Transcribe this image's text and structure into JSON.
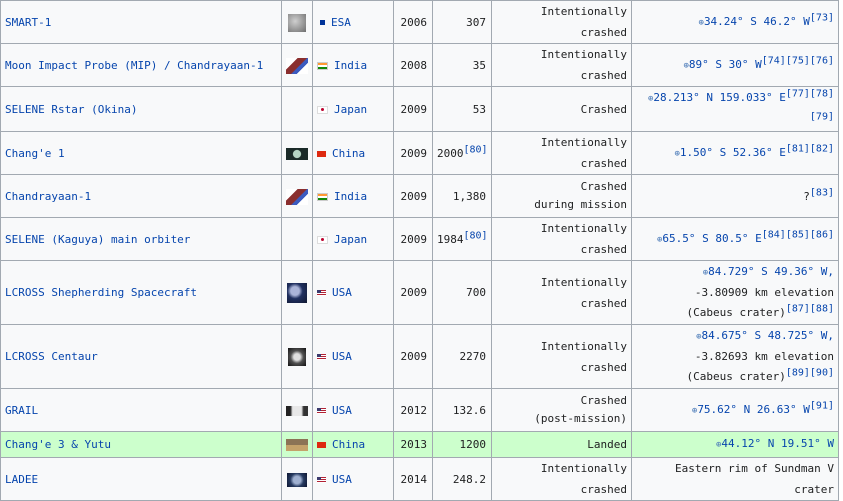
{
  "rows": [
    {
      "name": "SMART-1",
      "thumb": "moon-surface-icon",
      "flag": "esa-flag-icon",
      "country": "ESA",
      "year": "2006",
      "mass": "307",
      "mass_ref": "",
      "fate": [
        "Intentionally crashed"
      ],
      "loc_lines": [
        {
          "text": "34.24° S 46.2° W",
          "geo": true,
          "refs": "[73]"
        }
      ]
    },
    {
      "name": "Moon Impact Probe (MIP) / Chandrayaan-1",
      "thumb": "probe-icon",
      "flag": "india-flag-icon",
      "country": "India",
      "year": "2008",
      "mass": "35",
      "mass_ref": "",
      "fate": [
        "Intentionally crashed"
      ],
      "loc_lines": [
        {
          "text": "89° S 30° W",
          "geo": true,
          "refs": "[74][75][76]"
        }
      ]
    },
    {
      "name": "SELENE Rstar (Okina)",
      "thumb": "",
      "flag": "japan-flag-icon",
      "country": "Japan",
      "year": "2009",
      "mass": "53",
      "mass_ref": "",
      "fate": [
        "Crashed"
      ],
      "loc_lines": [
        {
          "text": "28.213° N 159.033° E",
          "geo": true,
          "refs": "[77][78][79]"
        }
      ]
    },
    {
      "name": "Chang'e 1",
      "thumb": "spacecraft-icon",
      "flag": "china-flag-icon",
      "country": "China",
      "year": "2009",
      "mass": "2000",
      "mass_ref": "[80]",
      "fate": [
        "Intentionally crashed"
      ],
      "loc_lines": [
        {
          "text": "1.50° S 52.36° E",
          "geo": true,
          "refs": "[81][82]"
        }
      ]
    },
    {
      "name": "Chandrayaan-1",
      "thumb": "probe-icon",
      "flag": "india-flag-icon",
      "country": "India",
      "year": "2009",
      "mass": "1,380",
      "mass_ref": "",
      "fate": [
        "Crashed",
        "during mission"
      ],
      "loc_lines": [
        {
          "text": "?",
          "geo": false,
          "refs": "[83]"
        }
      ]
    },
    {
      "name": "SELENE (Kaguya) main orbiter",
      "thumb": "",
      "flag": "japan-flag-icon",
      "country": "Japan",
      "year": "2009",
      "mass": "1984",
      "mass_ref": "[80]",
      "fate": [
        "Intentionally crashed"
      ],
      "loc_lines": [
        {
          "text": "65.5° S 80.5° E",
          "geo": true,
          "refs": "[84][85][86]"
        }
      ]
    },
    {
      "name": "LCROSS Shepherding Spacecraft",
      "thumb": "lcross-icon",
      "flag": "usa-flag-icon",
      "country": "USA",
      "year": "2009",
      "mass": "700",
      "mass_ref": "",
      "fate": [
        "Intentionally crashed"
      ],
      "loc_lines": [
        {
          "text": "84.729° S 49.36° W,",
          "geo": true,
          "refs": ""
        },
        {
          "text": "-3.80909  km elevation",
          "geo": false,
          "refs": ""
        },
        {
          "text": "(Cabeus crater)",
          "geo": false,
          "refs": "[87][88]"
        }
      ]
    },
    {
      "name": "LCROSS Centaur",
      "thumb": "centaur-icon",
      "flag": "usa-flag-icon",
      "country": "USA",
      "year": "2009",
      "mass": "2270",
      "mass_ref": "",
      "fate": [
        "Intentionally crashed"
      ],
      "loc_lines": [
        {
          "text": "84.675° S 48.725° W,",
          "geo": true,
          "refs": ""
        },
        {
          "text": "-3.82693  km elevation",
          "geo": false,
          "refs": ""
        },
        {
          "text": "(Cabeus crater)",
          "geo": false,
          "refs": "[89][90]"
        }
      ]
    },
    {
      "name": "GRAIL",
      "thumb": "grail-icon",
      "flag": "usa-flag-icon",
      "country": "USA",
      "year": "2012",
      "mass": "132.6",
      "mass_ref": "",
      "fate": [
        "Crashed",
        "(post-mission)"
      ],
      "loc_lines": [
        {
          "text": "75.62° N 26.63° W",
          "geo": true,
          "refs": "[91]"
        }
      ]
    },
    {
      "name": "Chang'e 3 & Yutu",
      "thumb": "rover-icon",
      "flag": "china-flag-icon",
      "country": "China",
      "year": "2013",
      "mass": "1200",
      "mass_ref": "",
      "fate": [
        "Landed"
      ],
      "loc_lines": [
        {
          "text": "44.12° N 19.51° W",
          "geo": true,
          "refs": ""
        }
      ],
      "highlight": true
    },
    {
      "name": "LADEE",
      "thumb": "ladee-icon",
      "flag": "usa-flag-icon",
      "country": "USA",
      "year": "2014",
      "mass": "248.2",
      "mass_ref": "",
      "fate": [
        "Intentionally crashed"
      ],
      "loc_lines": [
        {
          "text": "Eastern rim of Sundman V crater",
          "geo": false,
          "refs": ""
        }
      ]
    }
  ],
  "globe_glyph": "⊕"
}
